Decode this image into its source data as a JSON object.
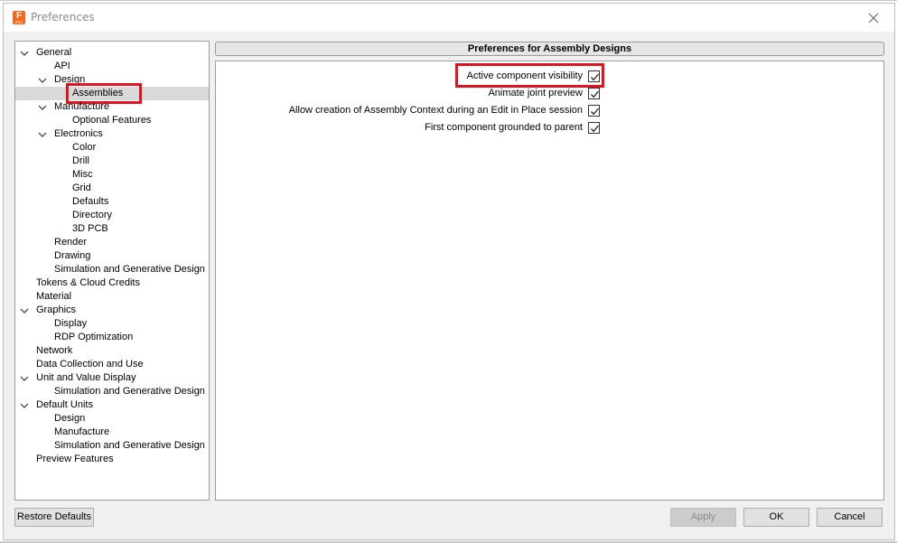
{
  "window": {
    "title": "Preferences",
    "icon": "fusion-app-icon",
    "icon_letter": "F",
    "icon_sub": "PRO",
    "close": "close-icon"
  },
  "tree": {
    "items": [
      {
        "label": "General",
        "level": 0,
        "expanded": true
      },
      {
        "label": "API",
        "level": 1
      },
      {
        "label": "Design",
        "level": 1,
        "expanded": true
      },
      {
        "label": "Assemblies",
        "level": 2,
        "selected": true
      },
      {
        "label": "Manufacture",
        "level": 1,
        "expanded": true
      },
      {
        "label": "Optional Features",
        "level": 2
      },
      {
        "label": "Electronics",
        "level": 1,
        "expanded": true
      },
      {
        "label": "Color",
        "level": 2
      },
      {
        "label": "Drill",
        "level": 2
      },
      {
        "label": "Misc",
        "level": 2
      },
      {
        "label": "Grid",
        "level": 2
      },
      {
        "label": "Defaults",
        "level": 2
      },
      {
        "label": "Directory",
        "level": 2
      },
      {
        "label": "3D PCB",
        "level": 2
      },
      {
        "label": "Render",
        "level": 1
      },
      {
        "label": "Drawing",
        "level": 1
      },
      {
        "label": "Simulation and Generative Design",
        "level": 1
      },
      {
        "label": "Tokens & Cloud Credits",
        "level": 0
      },
      {
        "label": "Material",
        "level": 0
      },
      {
        "label": "Graphics",
        "level": 0,
        "expanded": true
      },
      {
        "label": "Display",
        "level": 1
      },
      {
        "label": "RDP Optimization",
        "level": 1
      },
      {
        "label": "Network",
        "level": 0
      },
      {
        "label": "Data Collection and Use",
        "level": 0
      },
      {
        "label": "Unit and Value Display",
        "level": 0,
        "expanded": true
      },
      {
        "label": "Simulation and Generative Design",
        "level": 1
      },
      {
        "label": "Default Units",
        "level": 0,
        "expanded": true
      },
      {
        "label": "Design",
        "level": 1
      },
      {
        "label": "Manufacture",
        "level": 1
      },
      {
        "label": "Simulation and Generative Design",
        "level": 1
      },
      {
        "label": "Preview Features",
        "level": 0
      }
    ]
  },
  "panel": {
    "header": "Preferences for Assembly Designs",
    "options": [
      {
        "label": "Active component visibility",
        "checked": true,
        "highlighted": true
      },
      {
        "label": "Animate joint preview",
        "checked": true
      },
      {
        "label": "Allow creation of Assembly Context during an Edit in Place session",
        "checked": true
      },
      {
        "label": "First component grounded to parent",
        "checked": true
      }
    ]
  },
  "footer": {
    "restore_defaults": "Restore Defaults",
    "apply": "Apply",
    "ok": "OK",
    "cancel": "Cancel",
    "apply_enabled": false
  },
  "colors": {
    "highlight": "#e0131f",
    "selection": "#d9d9d9",
    "app_icon": "#f26b1d"
  }
}
